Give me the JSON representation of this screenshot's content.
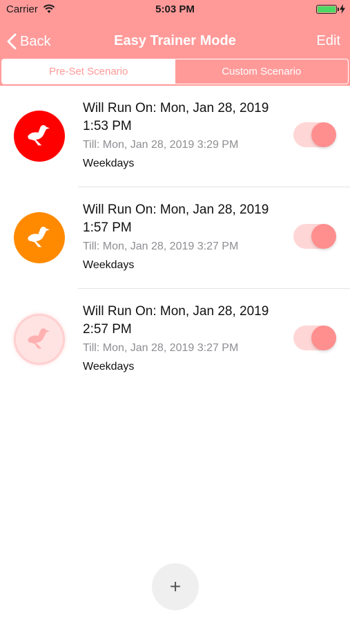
{
  "status_bar": {
    "carrier": "Carrier",
    "time": "5:03 PM"
  },
  "nav": {
    "back_label": "Back",
    "title": "Easy Trainer Mode",
    "edit_label": "Edit"
  },
  "segments": {
    "preset": "Pre-Set Scenario",
    "custom": "Custom Scenario",
    "selected": "preset"
  },
  "scenarios": [
    {
      "title": "Will Run On: Mon, Jan 28, 2019 1:53 PM",
      "till": "Till: Mon, Jan 28, 2019 3:29 PM",
      "repeat": "Weekdays",
      "enabled": true,
      "icon": "bird-icon",
      "icon_color": "#ff0000"
    },
    {
      "title": "Will Run On: Mon, Jan 28, 2019 1:57 PM",
      "till": "Till: Mon, Jan 28, 2019 3:27 PM",
      "repeat": "Weekdays",
      "enabled": true,
      "icon": "bird-icon",
      "icon_color": "#ff8a00"
    },
    {
      "title": "Will Run On: Mon, Jan 28, 2019 2:57 PM",
      "till": "Till: Mon, Jan 28, 2019 3:27 PM",
      "repeat": "Weekdays",
      "enabled": true,
      "icon": "bird-icon",
      "icon_color": "#ffe3e3"
    }
  ],
  "add_button": {
    "label": "+"
  },
  "colors": {
    "accent": "#ff9a99",
    "toggle_track": "#ffd6d6",
    "toggle_knob": "#ff8e8e"
  }
}
